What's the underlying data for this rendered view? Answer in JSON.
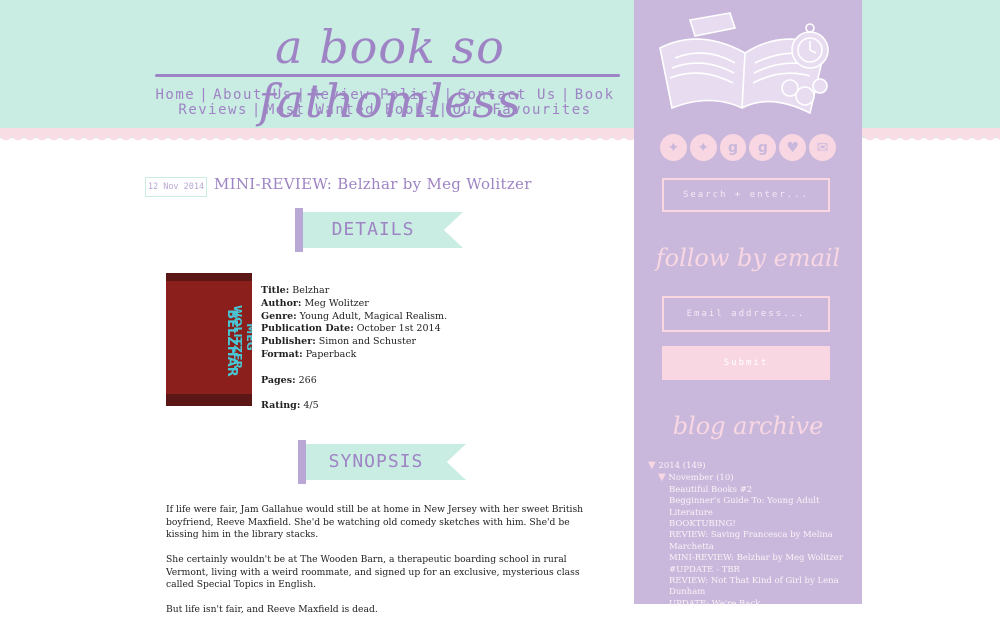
{
  "header": {
    "site_title": "a book so fathomless",
    "nav": [
      "Home",
      "About Us",
      "Review Policy",
      "Contact Us",
      "Book Reviews",
      "Most Wanted Books",
      "Our Favourites"
    ]
  },
  "post": {
    "date": "12 Nov 2014",
    "title": "MINI-REVIEW: Belzhar by Meg Wolitzer",
    "details_heading": "DETAILS",
    "synopsis_heading": "SYNOPSIS",
    "cover": {
      "author": "MEG WOLITZER",
      "book": "BELZHAR"
    },
    "details": {
      "title_label": "Title:",
      "title": "Belzhar",
      "author_label": "Author:",
      "author": "Meg Wolitzer",
      "genre_label": "Genre:",
      "genre": "Young Adult, Magical Realism.",
      "pubdate_label": "Publication Date:",
      "pubdate": "October 1st 2014",
      "publisher_label": "Publisher:",
      "publisher": "Simon and Schuster",
      "format_label": "Format:",
      "format": "Paperback",
      "pages_label": "Pages:",
      "pages": "266",
      "rating_label": "Rating:",
      "rating": "4/5"
    },
    "synopsis": [
      "If life were fair, Jam Gallahue would still be at home in New Jersey with her sweet British boyfriend, Reeve Maxfield. She'd be watching old comedy sketches with him. She'd be kissing him in the library stacks.",
      "She certainly wouldn't be at The Wooden Barn, a therapeutic boarding school in rural Vermont, living with a weird roommate, and signed up for an exclusive, mysterious class called Special Topics in English.",
      "But life isn't fair, and Reeve Maxfield is dead."
    ]
  },
  "sidebar": {
    "social_icons": [
      "twitter-icon",
      "twitter-icon",
      "goodreads-icon",
      "goodreads-icon",
      "bloglovin-icon",
      "email-icon"
    ],
    "search_placeholder": "Search + enter...",
    "follow_heading": "follow by email",
    "email_placeholder": "Email address...",
    "submit_label": "Submit",
    "archive_heading": "blog archive",
    "archive": {
      "year": "2014",
      "year_count": "(149)",
      "month": "November",
      "month_count": "(10)",
      "posts": [
        "Beautiful Books #2",
        "Begginner's Guide To: Young Adult Literature",
        "BOOKTUBING!",
        "REVIEW: Saving Francesca by Melina Marchetta",
        "MINI-REVIEW: Belzhar by Meg Wolitzer",
        "#UPDATE - TBR",
        "REVIEW: Not That Kind of Girl by Lena Dunham",
        "UPDATE: We're Back"
      ]
    }
  },
  "colors": {
    "mint": "#c9ece3",
    "lavender": "#c9b8dc",
    "purple_text": "#9e84c4",
    "pink": "#f8d7e2"
  }
}
